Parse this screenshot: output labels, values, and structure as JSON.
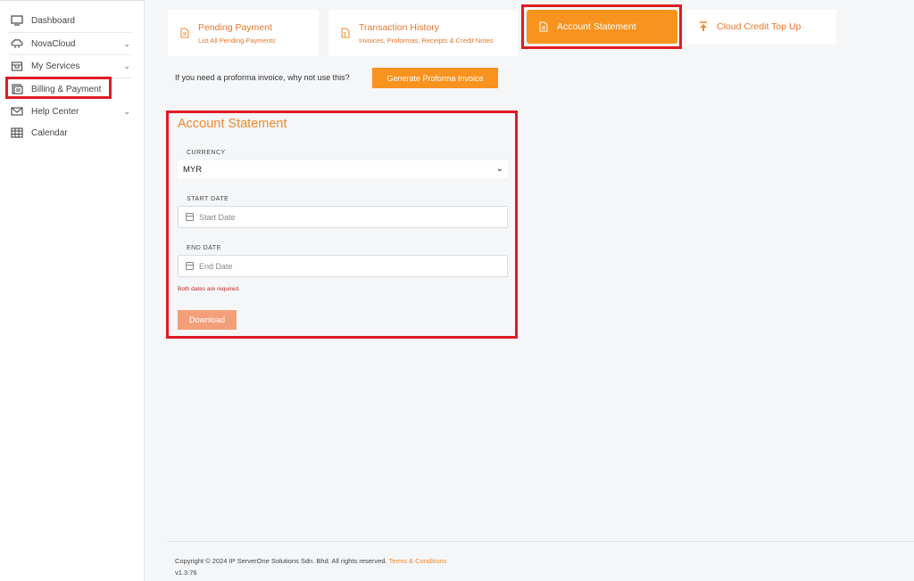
{
  "sidebar": {
    "items": [
      {
        "label": "Dashboard",
        "icon": "monitor-icon"
      },
      {
        "label": "NovaCloud",
        "icon": "cloud-icon"
      },
      {
        "label": "My Services",
        "icon": "box-icon"
      },
      {
        "label": "Billing & Payment",
        "icon": "billing-icon"
      },
      {
        "label": "Help Center",
        "icon": "envelope-icon"
      },
      {
        "label": "Calendar",
        "icon": "calendar-grid-icon"
      }
    ]
  },
  "tabs": [
    {
      "title": "Pending Payment",
      "subtitle": "List All Pending Payments"
    },
    {
      "title": "Transaction History",
      "subtitle": "Invoices, Proformas, Receipts & Credit Notes"
    },
    {
      "title": "Account Statement"
    },
    {
      "title": "Cloud Credit Top Up"
    }
  ],
  "proforma": {
    "text": "If you need a proforma invoice, why not use this?",
    "button": "Generate Proforma Invoice"
  },
  "statement": {
    "title": "Account Statement",
    "currency_label": "CURRENCY",
    "currency_value": "MYR",
    "start_label": "START DATE",
    "start_placeholder": "Start Date",
    "end_label": "END DATE",
    "end_placeholder": "End Date",
    "error": "Both dates are required.",
    "download": "Download"
  },
  "footer": {
    "copyright": "Copyright © 2024 IP ServerOne Solutions Sdn. Bhd. All rights reserved.",
    "terms": "Terms & Conditions",
    "version": "v1.3.76"
  },
  "colors": {
    "accent": "#f7931e",
    "accent_text": "#e8762b",
    "highlight": "#e01b24",
    "download_disabled": "#f3a07a"
  }
}
